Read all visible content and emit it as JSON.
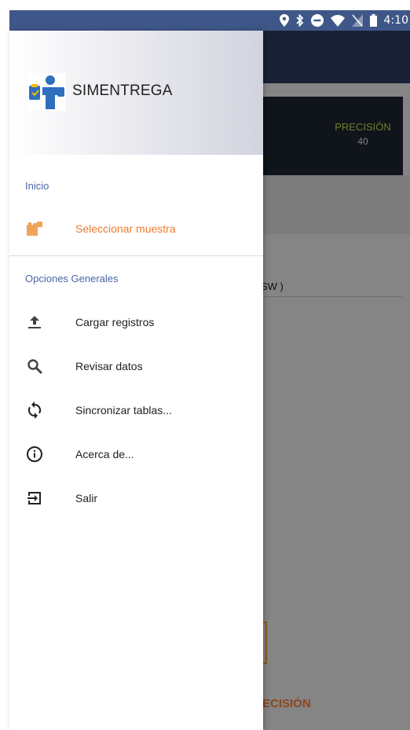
{
  "status_bar": {
    "time": "4:10",
    "icons": [
      "location-icon",
      "bluetooth-icon",
      "do-not-disturb-icon",
      "wifi-icon",
      "no-sim-icon",
      "battery-icon"
    ],
    "color": "#3f5788"
  },
  "background": {
    "precision_label": "PRECISIÓN",
    "precision_value": "40",
    "partial_text": "SW )",
    "bottom_partial_label": "ECISIÓN"
  },
  "drawer": {
    "app_name": "SIMENTREGA",
    "logo": "simentrega-logo",
    "sections": [
      {
        "label": "Inicio",
        "items": [
          {
            "label": "Seleccionar muestra",
            "icon": "select-sample-icon",
            "active": true
          }
        ]
      },
      {
        "label": "Opciones Generales",
        "items": [
          {
            "label": "Cargar registros",
            "icon": "upload-icon"
          },
          {
            "label": "Revisar datos",
            "icon": "search-icon"
          },
          {
            "label": "Sincronizar tablas...",
            "icon": "sync-icon"
          },
          {
            "label": "Acerca de...",
            "icon": "info-icon"
          },
          {
            "label": "Salir",
            "icon": "exit-icon"
          }
        ]
      }
    ]
  },
  "colors": {
    "accent": "#ef7a2f",
    "section_label": "#4a64a4",
    "precision_green": "#b7d84a"
  }
}
